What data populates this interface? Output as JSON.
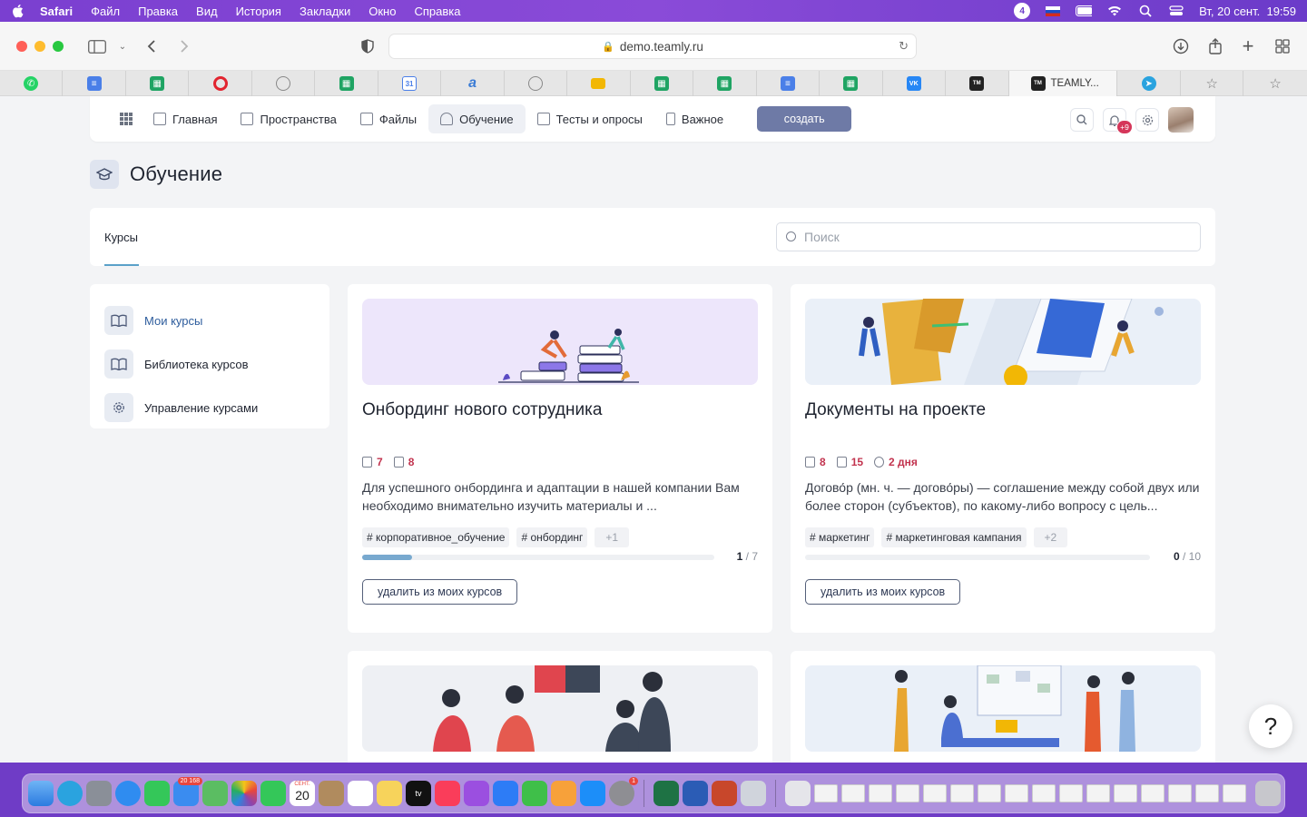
{
  "menubar": {
    "app": "Safari",
    "items": [
      "Файл",
      "Правка",
      "Вид",
      "История",
      "Закладки",
      "Окно",
      "Справка"
    ],
    "notif_count": "4",
    "datetime": "Вт, 20 сент.  19:59"
  },
  "browser": {
    "url": "demo.teamly.ru",
    "active_tab_title": "TEAMLY...",
    "tab_favicons": [
      {
        "name": "whatsapp",
        "color": "#25d366"
      },
      {
        "name": "google-docs",
        "color": "#4a7fe8"
      },
      {
        "name": "google-sheets",
        "color": "#1fa463"
      },
      {
        "name": "opera",
        "color": "#e2242f"
      },
      {
        "name": "compass",
        "color": "#9aa0aa"
      },
      {
        "name": "google-sheets",
        "color": "#1fa463"
      },
      {
        "name": "google-calendar",
        "color": "#4a7fe8"
      },
      {
        "name": "a-icon",
        "color": "#3a7bd5"
      },
      {
        "name": "compass",
        "color": "#9aa0aa"
      },
      {
        "name": "gmail",
        "color": "#f2b705"
      },
      {
        "name": "google-sheets",
        "color": "#1fa463"
      },
      {
        "name": "google-sheets",
        "color": "#1fa463"
      },
      {
        "name": "google-docs",
        "color": "#4a7fe8"
      },
      {
        "name": "google-sheets",
        "color": "#1fa463"
      },
      {
        "name": "vk",
        "color": "#2787f5"
      },
      {
        "name": "teamly",
        "color": "#222222"
      }
    ]
  },
  "nav": {
    "items": [
      {
        "label": "Главная",
        "icon": "home-icon"
      },
      {
        "label": "Пространства",
        "icon": "spaces-icon"
      },
      {
        "label": "Файлы",
        "icon": "folder-icon"
      },
      {
        "label": "Обучение",
        "icon": "graduation-icon",
        "active": true
      },
      {
        "label": "Тесты и опросы",
        "icon": "tests-icon"
      },
      {
        "label": "Важное",
        "icon": "bookmark-icon"
      }
    ],
    "create_label": "создать",
    "notif_badge": "+9"
  },
  "page": {
    "title": "Обучение",
    "tab_label": "Курсы",
    "search_placeholder": "Поиск"
  },
  "sidebar": {
    "items": [
      {
        "label": "Мои курсы",
        "active": true
      },
      {
        "label": "Библиотека курсов"
      },
      {
        "label": "Управление курсами"
      }
    ]
  },
  "courses": [
    {
      "title": "Онбординг нового сотрудника",
      "materials": "7",
      "tests": "8",
      "duration": "",
      "description": "Для успешного онбординга и адаптации в нашей компании Вам необходимо внимательно изучить материалы и ...",
      "tags": [
        "# корпоративное_обучение",
        "# онбординг"
      ],
      "more_tags": "+1",
      "progress_done": "1",
      "progress_total": "7",
      "progress_fraction": 0.142,
      "remove_label": "удалить из моих курсов"
    },
    {
      "title": "Документы на проекте",
      "materials": "8",
      "tests": "15",
      "duration": "2 дня",
      "description": "Догово́р (мн. ч. — догово́ры) — соглашение между собой двух или более сторон (субъектов), по какому-либо вопросу с цель...",
      "tags": [
        "# маркетинг",
        "# маркетинговая кампания"
      ],
      "more_tags": "+2",
      "progress_done": "0",
      "progress_total": "10",
      "progress_fraction": 0,
      "remove_label": "удалить из моих курсов"
    }
  ],
  "help_label": "?",
  "dock": {
    "mail_badge": "20 168",
    "calendar_month": "СЕНТ.",
    "calendar_day": "20",
    "settings_badge": "1"
  },
  "colors": {
    "accent": "#6e7aa6",
    "progress": "#78a9cf",
    "meta_red": "#c2334e",
    "active_link": "#2e5d9d"
  }
}
